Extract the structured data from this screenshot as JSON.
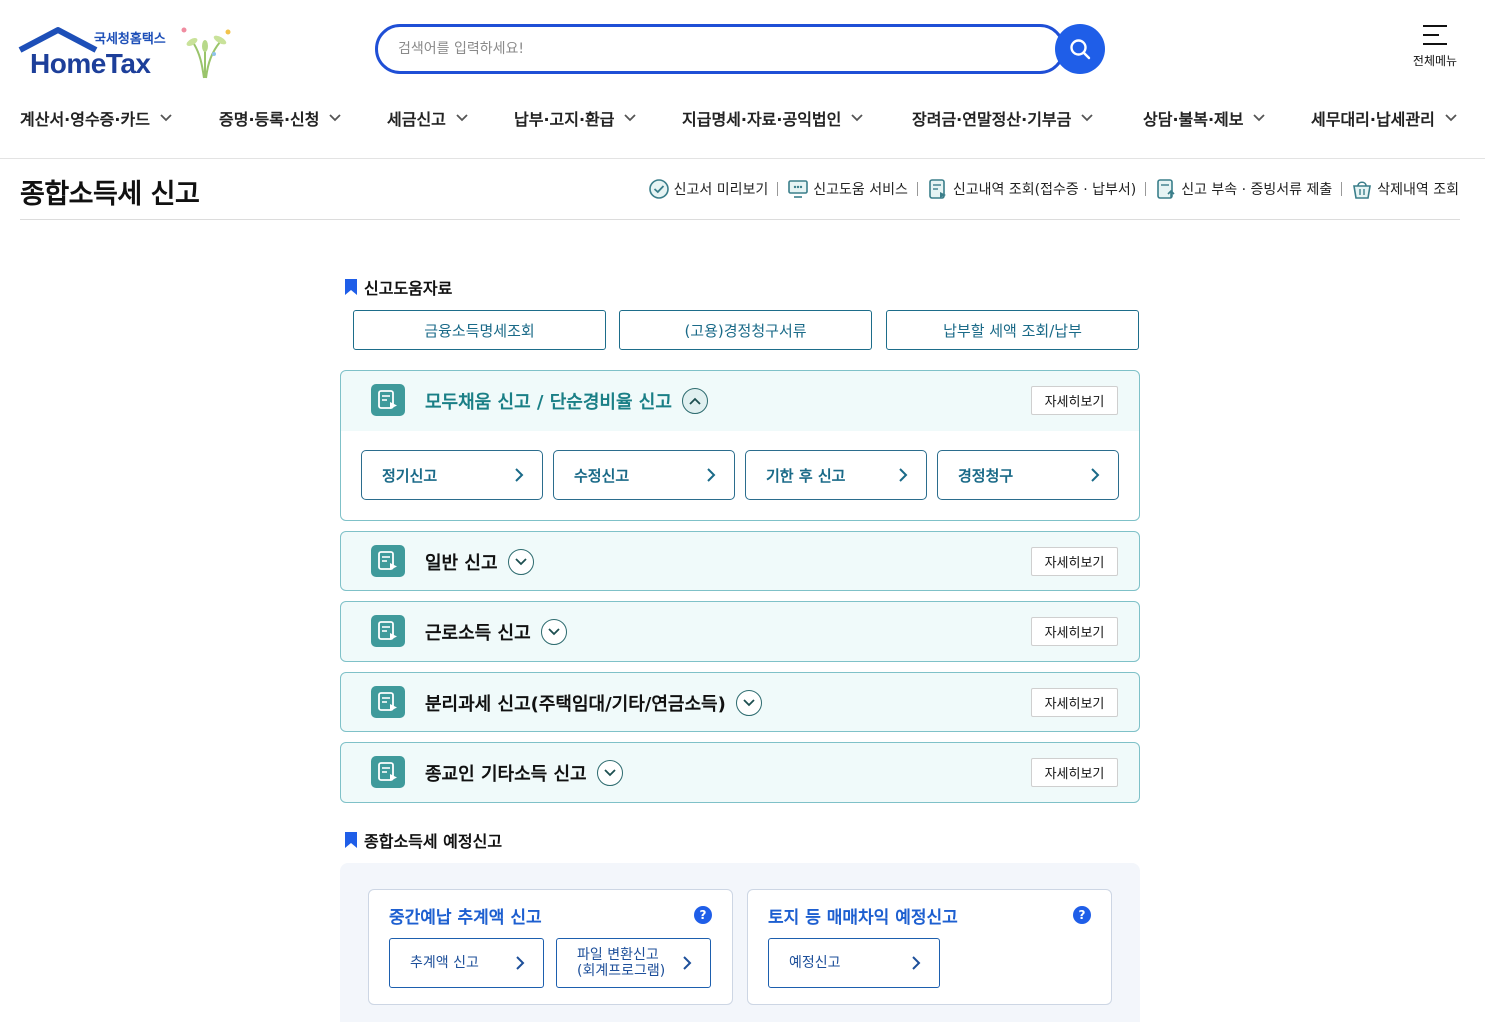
{
  "logo": {
    "sub": "국세청홈택스",
    "main": "HomeTax"
  },
  "search": {
    "placeholder": "검색어를 입력하세요!"
  },
  "all_menu": {
    "label": "전체메뉴"
  },
  "gnb": [
    "계산서·영수증·카드",
    "증명·등록·신청",
    "세금신고",
    "납부·고지·환급",
    "지급명세·자료·공익법인",
    "장려금·연말정산·기부금",
    "상담·불복·제보",
    "세무대리·납세관리"
  ],
  "page": {
    "title": "종합소득세 신고",
    "utils": [
      {
        "label": "신고서 미리보기",
        "icon": "check-circle-icon"
      },
      {
        "label": "신고도움 서비스",
        "icon": "monitor-icon"
      },
      {
        "label": "신고내역 조회(접수증 · 납부서)",
        "icon": "document-search-icon"
      },
      {
        "label": "신고 부속 · 증빙서류 제출",
        "icon": "document-upload-icon"
      },
      {
        "label": "삭제내역 조회",
        "icon": "trash-basket-icon"
      }
    ]
  },
  "help": {
    "title": "신고도움자료",
    "buttons": [
      "금융소득명세조회",
      "(고용)경정청구서류",
      "납부할 세액 조회/납부"
    ]
  },
  "accordions": [
    {
      "title": "모두채움 신고 / 단순경비율 신고",
      "more": "자세히보기",
      "open": true,
      "subs": [
        "정기신고",
        "수정신고",
        "기한 후 신고",
        "경정청구"
      ]
    },
    {
      "title": "일반 신고",
      "more": "자세히보기",
      "open": false
    },
    {
      "title": "근로소득 신고",
      "more": "자세히보기",
      "open": false
    },
    {
      "title": "분리과세 신고(주택임대/기타/연금소득)",
      "more": "자세히보기",
      "open": false
    },
    {
      "title": "종교인 기타소득 신고",
      "more": "자세히보기",
      "open": false
    }
  ],
  "pre": {
    "title": "종합소득세 예정신고",
    "cards": [
      {
        "title": "중간예납 추계액 신고",
        "help": "?",
        "buttons": [
          "추계액 신고",
          "파일 변환신고\n(회계프로그램)"
        ]
      },
      {
        "title": "토지 등 매매차익 예정신고",
        "help": "?",
        "buttons": [
          "예정신고"
        ]
      }
    ]
  },
  "colors": {
    "primary": "#1f5ee8",
    "teal": "#3f9a9b",
    "teal_text": "#1a7f86",
    "accordion_bg": "#f0fafa"
  }
}
